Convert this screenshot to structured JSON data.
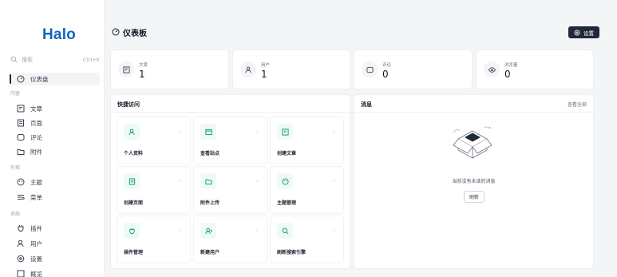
{
  "sidebar": {
    "logo": "Halo",
    "search": {
      "placeholder": "搜索",
      "shortcut": "Ctrl+K"
    },
    "items": [
      {
        "label": "仪表盘",
        "icon": "dashboard-icon",
        "active": true
      },
      {
        "group": "内容"
      },
      {
        "label": "文章",
        "icon": "article-icon"
      },
      {
        "label": "页面",
        "icon": "page-icon"
      },
      {
        "label": "评论",
        "icon": "comment-icon"
      },
      {
        "label": "附件",
        "icon": "folder-icon"
      },
      {
        "group": "外观"
      },
      {
        "label": "主题",
        "icon": "palette-icon"
      },
      {
        "label": "菜单",
        "icon": "menu-icon"
      },
      {
        "group": "系统"
      },
      {
        "label": "插件",
        "icon": "plug-icon"
      },
      {
        "label": "用户",
        "icon": "user-icon"
      },
      {
        "label": "设置",
        "icon": "gear-icon"
      },
      {
        "label": "概览",
        "icon": "overview-icon"
      }
    ]
  },
  "header": {
    "title": "仪表板",
    "title_icon": "dashboard-icon",
    "settings_label": "设置"
  },
  "stats": [
    {
      "label": "文章",
      "value": "1",
      "icon": "article-icon"
    },
    {
      "label": "用户",
      "value": "1",
      "icon": "user-icon"
    },
    {
      "label": "评论",
      "value": "0",
      "icon": "comment-icon"
    },
    {
      "label": "浏览量",
      "value": "0",
      "icon": "eye-icon"
    }
  ],
  "quick_access": {
    "title": "快捷访问",
    "tiles": [
      {
        "label": "个人资料",
        "icon": "user-icon"
      },
      {
        "label": "查看站点",
        "icon": "browser-icon"
      },
      {
        "label": "创建文章",
        "icon": "article-icon"
      },
      {
        "label": "创建页面",
        "icon": "page-icon"
      },
      {
        "label": "附件上传",
        "icon": "folder-icon"
      },
      {
        "label": "主题管理",
        "icon": "palette-icon"
      },
      {
        "label": "插件管理",
        "icon": "plug-icon"
      },
      {
        "label": "新建用户",
        "icon": "user-add-icon"
      },
      {
        "label": "刷新搜索引擎",
        "icon": "search-icon"
      }
    ]
  },
  "notifications": {
    "title": "消息",
    "view_all": "查看全部",
    "empty_text": "当前没有未读的消息",
    "refresh_label": "刷新"
  },
  "colors": {
    "brand": "#1565c0",
    "tile_icon": "#059669",
    "button_dark": "#1f2937"
  }
}
